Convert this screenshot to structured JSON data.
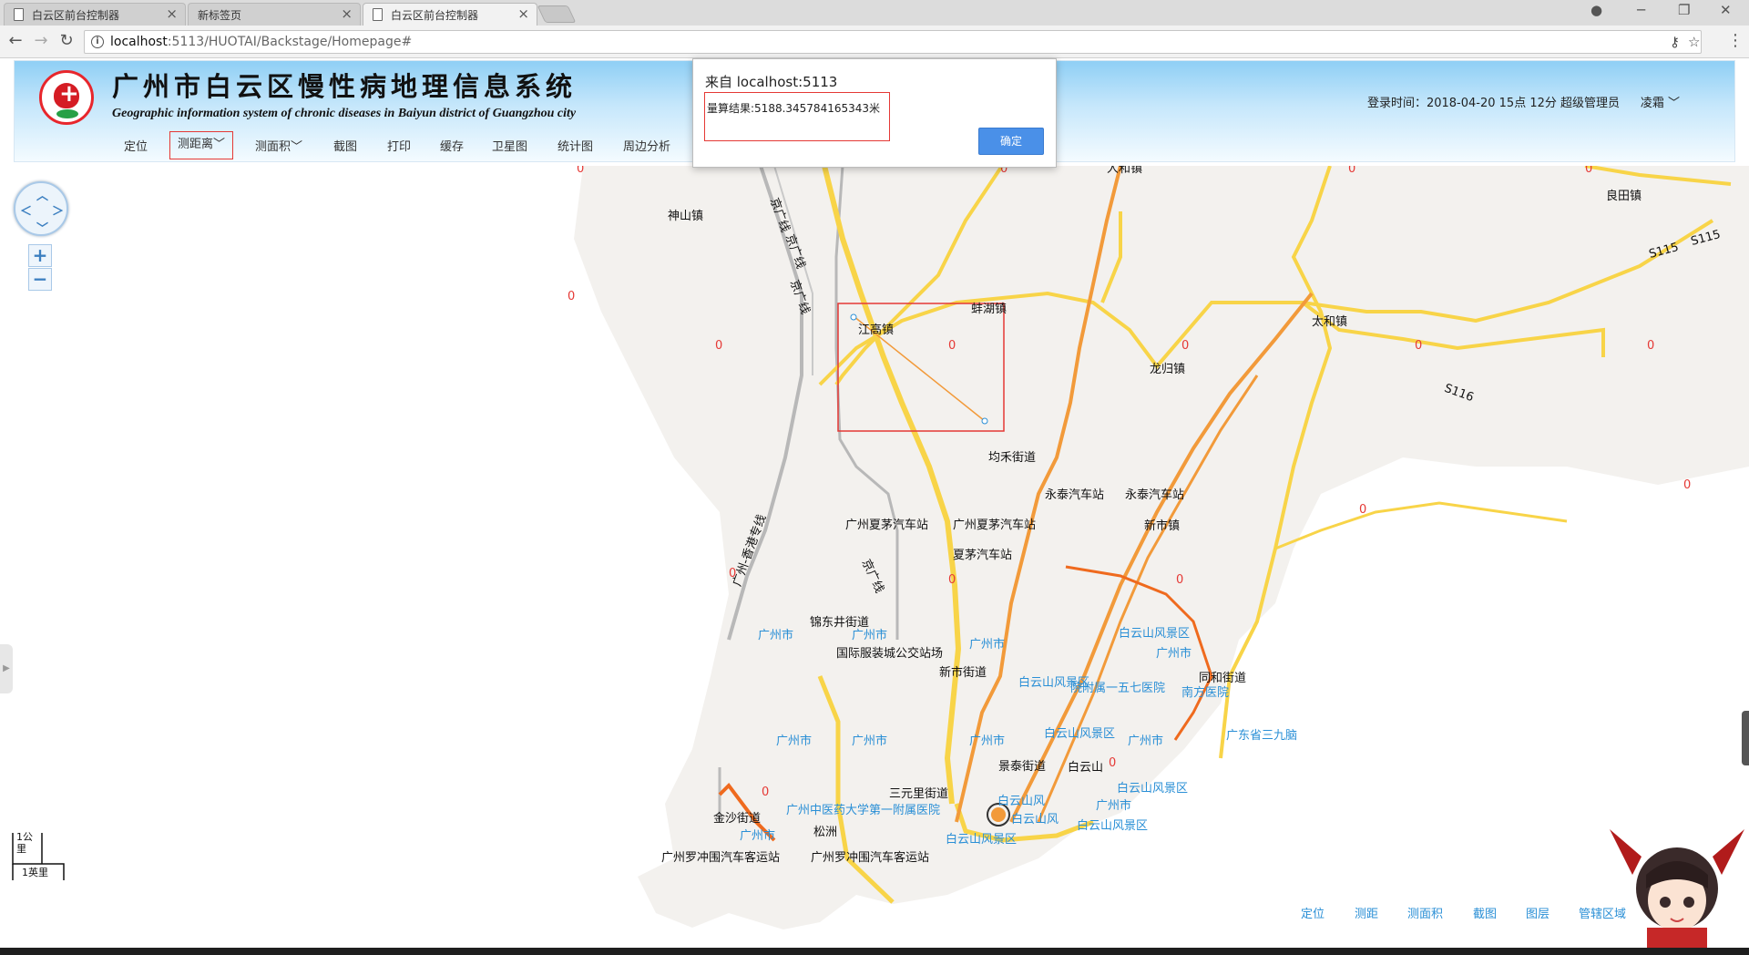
{
  "browser": {
    "tabs": [
      {
        "title": "白云区前台控制器",
        "active": false
      },
      {
        "title": "新标签页",
        "active": false
      },
      {
        "title": "白云区前台控制器",
        "active": true
      }
    ],
    "url_host": "localhost",
    "url_rest": ":5113/HUOTAI/Backstage/Homepage#"
  },
  "header": {
    "title": "广州市白云区慢性病地理信息系统",
    "subtitle": "Geographic information system of chronic diseases in Baiyun district of Guangzhou city",
    "login_info": "登录时间：2018-04-20  15点  12分    超级管理员",
    "user_name": "凌霜"
  },
  "menu": {
    "items": [
      "定位",
      "测距离",
      "测面积",
      "截图",
      "打印",
      "缓存",
      "卫星图",
      "统计图",
      "周边分析"
    ]
  },
  "dialog": {
    "origin": "来自 localhost:5113",
    "result": "量算结果:5188.345784165343米",
    "ok_label": "确定"
  },
  "map": {
    "places": [
      {
        "text": "神山镇",
        "color": "black"
      },
      {
        "text": "人和镇",
        "color": "black"
      },
      {
        "text": "良田镇",
        "color": "black"
      },
      {
        "text": "江高镇",
        "color": "black"
      },
      {
        "text": "蚌湖镇",
        "color": "black"
      },
      {
        "text": "太和镇",
        "color": "black"
      },
      {
        "text": "龙归镇",
        "color": "black"
      },
      {
        "text": "均禾街道",
        "color": "black"
      },
      {
        "text": "永泰汽车站",
        "color": "black"
      },
      {
        "text": "永泰汽车站",
        "color": "black"
      },
      {
        "text": "新市镇",
        "color": "black"
      },
      {
        "text": "广州夏茅汽车站",
        "color": "black"
      },
      {
        "text": "广州夏茅汽车站",
        "color": "black"
      },
      {
        "text": "夏茅汽车站",
        "color": "black"
      },
      {
        "text": "锦东井街道",
        "color": "black"
      },
      {
        "text": "国际服装城公交站场",
        "color": "black"
      },
      {
        "text": "新市街道",
        "color": "black"
      },
      {
        "text": "同和街道",
        "color": "black"
      },
      {
        "text": "景泰街道",
        "color": "black"
      },
      {
        "text": "白云山",
        "color": "black"
      },
      {
        "text": "三元里街道",
        "color": "black"
      },
      {
        "text": "金沙街道",
        "color": "black"
      },
      {
        "text": "松洲",
        "color": "black"
      },
      {
        "text": "广州罗冲围汽车客运站",
        "color": "black"
      },
      {
        "text": "广州罗冲围汽车客运站",
        "color": "black"
      },
      {
        "text": "广州市",
        "color": "blue"
      },
      {
        "text": "广州市",
        "color": "blue"
      },
      {
        "text": "广州市",
        "color": "blue"
      },
      {
        "text": "广州市",
        "color": "blue"
      },
      {
        "text": "广州市",
        "color": "blue"
      },
      {
        "text": "广州市",
        "color": "blue"
      },
      {
        "text": "广州市",
        "color": "blue"
      },
      {
        "text": "广州市",
        "color": "blue"
      },
      {
        "text": "广州市",
        "color": "blue"
      },
      {
        "text": "广州市",
        "color": "blue"
      },
      {
        "text": "白云山风景区",
        "color": "blue"
      },
      {
        "text": "白云山风景区",
        "color": "blue"
      },
      {
        "text": "白云山风景区",
        "color": "blue"
      },
      {
        "text": "白云山风景区",
        "color": "blue"
      },
      {
        "text": "白云山风景区",
        "color": "blue"
      },
      {
        "text": "白云山风景区",
        "color": "blue"
      },
      {
        "text": "院附属一五七医院",
        "color": "blue"
      },
      {
        "text": "南方医院",
        "color": "blue"
      },
      {
        "text": "广东省三九脑",
        "color": "blue"
      },
      {
        "text": "广州中医药大学第一附属医院",
        "color": "blue"
      },
      {
        "text": "白云山风",
        "color": "blue"
      },
      {
        "text": "白云山风",
        "color": "blue"
      }
    ],
    "counts": [
      "0",
      "0",
      "0",
      "0",
      "0",
      "0",
      "0",
      "0",
      "0",
      "0",
      "0",
      "0",
      "0",
      "0",
      "0",
      "0",
      "0"
    ],
    "roads": [
      "京广线",
      "京广线",
      "京广线",
      "京广线",
      "S115",
      "S115",
      "S116",
      "广州-香港专线"
    ],
    "scale_km": "1公里",
    "scale_mile": "1英里"
  },
  "bottom_tools": [
    "定位",
    "测距",
    "测面积",
    "截图",
    "图层",
    "管辖区域"
  ],
  "colors": {
    "header_top": "#8fcff5",
    "accent_red": "#e53935",
    "map_land": "#f3f1ee",
    "road_yellow": "#f8d448",
    "road_orange": "#f29a3a",
    "link_blue": "#2a8fd6"
  }
}
